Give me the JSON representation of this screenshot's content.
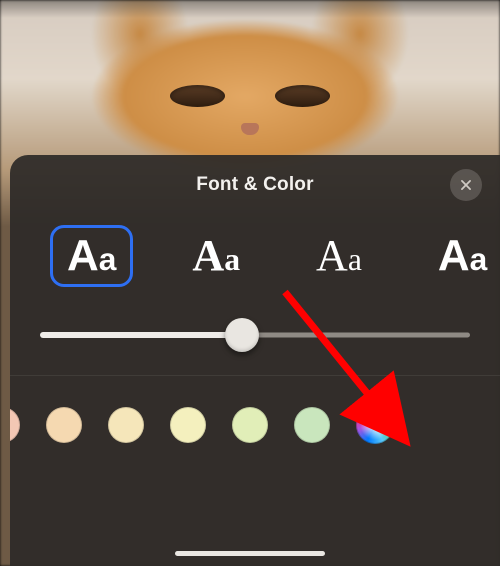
{
  "sheet": {
    "title": "Font & Color",
    "close_label": "Close"
  },
  "fonts": {
    "options": [
      {
        "sample": "Aa",
        "selected": true,
        "style": "f-sans"
      },
      {
        "sample": "Aa",
        "selected": false,
        "style": "f-slab"
      },
      {
        "sample": "Aa",
        "selected": false,
        "style": "f-serif"
      },
      {
        "sample": "Aa",
        "selected": false,
        "style": "f-display"
      }
    ]
  },
  "slider": {
    "min": 0,
    "max": 100,
    "value": 47
  },
  "swatches": {
    "colors": [
      "#f3c7b4",
      "#f5d9b1",
      "#f5e6ba",
      "#f4f0be",
      "#e1eeb8",
      "#c9e6bd"
    ],
    "wheel_label": "color-wheel"
  },
  "annotation": {
    "arrow_target": "color-wheel-button"
  }
}
